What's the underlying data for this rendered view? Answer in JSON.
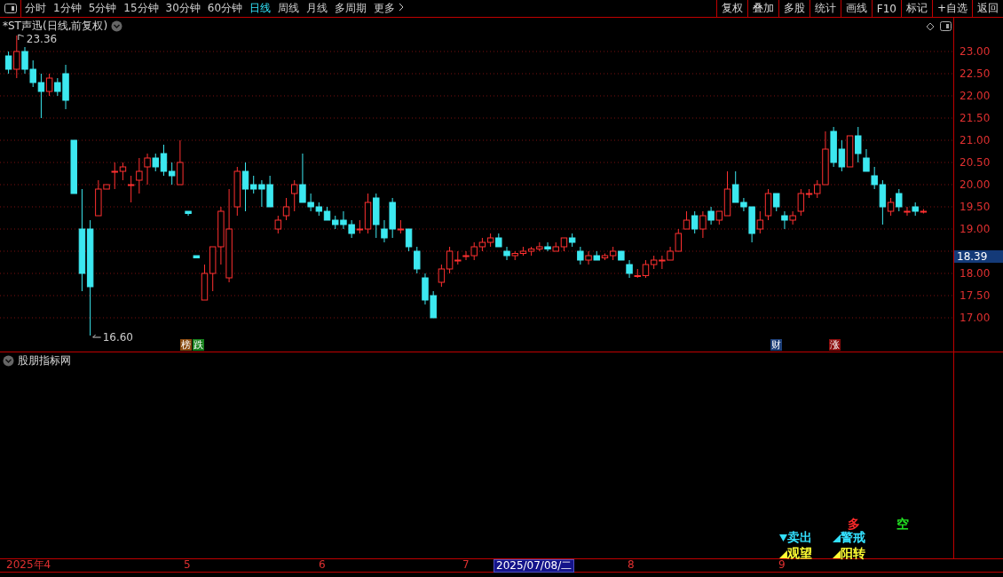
{
  "toolbar": {
    "periods": [
      {
        "label": "分时",
        "selected": false
      },
      {
        "label": "1分钟",
        "selected": false
      },
      {
        "label": "5分钟",
        "selected": false
      },
      {
        "label": "15分钟",
        "selected": false
      },
      {
        "label": "30分钟",
        "selected": false
      },
      {
        "label": "60分钟",
        "selected": false
      },
      {
        "label": "日线",
        "selected": true
      },
      {
        "label": "周线",
        "selected": false
      },
      {
        "label": "月线",
        "selected": false
      },
      {
        "label": "多周期",
        "selected": false
      }
    ],
    "more": "更多",
    "actions": [
      "复权",
      "叠加",
      "多股",
      "统计",
      "画线",
      "F10",
      "标记",
      "+自选",
      "返回"
    ]
  },
  "chart": {
    "title": "*ST声迅(日线,前复权)",
    "high_label": "23.36",
    "low_label": "16.60",
    "current_price": "18.39",
    "chart_data": {
      "type": "candlestick",
      "ylim": [
        11.56,
        23.76
      ],
      "grid": true,
      "yticks": [
        {
          "value": 23,
          "label": "23.00"
        },
        {
          "value": 22.5,
          "label": "22.50"
        },
        {
          "value": 22,
          "label": "22.00"
        },
        {
          "value": 21.5,
          "label": "21.50"
        },
        {
          "value": 21,
          "label": "21.00"
        },
        {
          "value": 20.5,
          "label": "20.50"
        },
        {
          "value": 20,
          "label": "20.00"
        },
        {
          "value": 19.5,
          "label": "19.50"
        },
        {
          "value": 19,
          "label": "19.00"
        },
        {
          "value": 18,
          "label": "18.00"
        },
        {
          "value": 17.5,
          "label": "17.50"
        },
        {
          "value": 17,
          "label": "17.00"
        }
      ],
      "ohlc": [
        [
          22.9,
          23.0,
          22.5,
          22.6
        ],
        [
          22.6,
          23.36,
          22.4,
          23.0
        ],
        [
          23.0,
          23.1,
          22.5,
          22.6
        ],
        [
          22.6,
          22.8,
          22.2,
          22.3
        ],
        [
          22.3,
          22.5,
          21.5,
          22.1
        ],
        [
          22.1,
          22.5,
          22.0,
          22.4
        ],
        [
          22.3,
          22.4,
          22.0,
          22.1
        ],
        [
          22.5,
          22.7,
          21.7,
          21.9
        ],
        [
          21.0,
          21.0,
          19.8,
          19.8
        ],
        [
          19.0,
          19.9,
          17.6,
          18.0
        ],
        [
          19.0,
          19.2,
          16.6,
          17.7
        ],
        [
          19.3,
          20.1,
          19.3,
          19.9
        ],
        [
          19.9,
          20.0,
          19.9,
          20.0
        ],
        [
          20.3,
          20.5,
          19.9,
          20.3
        ],
        [
          20.3,
          20.5,
          20.1,
          20.4
        ],
        [
          20.0,
          20.2,
          19.6,
          20.0
        ],
        [
          20.1,
          20.6,
          19.8,
          20.3
        ],
        [
          20.4,
          20.7,
          20.0,
          20.6
        ],
        [
          20.6,
          20.7,
          20.3,
          20.4
        ],
        [
          20.7,
          20.9,
          20.2,
          20.3
        ],
        [
          20.3,
          20.5,
          20.0,
          20.2
        ],
        [
          20.0,
          21.0,
          20.0,
          20.5
        ],
        [
          19.4,
          19.4,
          19.3,
          19.35
        ],
        [
          18.4,
          18.4,
          18.35,
          18.35
        ],
        [
          17.4,
          18.2,
          17.4,
          18.0
        ],
        [
          18.0,
          18.6,
          17.6,
          18.6
        ],
        [
          18.6,
          19.5,
          18.2,
          19.4
        ],
        [
          17.9,
          19.9,
          17.8,
          19.0
        ],
        [
          19.5,
          20.4,
          19.3,
          20.3
        ],
        [
          20.3,
          20.5,
          19.4,
          19.9
        ],
        [
          20.0,
          20.2,
          19.8,
          19.9
        ],
        [
          20.0,
          20.1,
          19.5,
          19.9
        ],
        [
          20.0,
          20.2,
          19.5,
          19.5
        ],
        [
          19.0,
          19.3,
          18.9,
          19.2
        ],
        [
          19.3,
          19.7,
          19.2,
          19.5
        ],
        [
          19.8,
          20.1,
          19.4,
          20.0
        ],
        [
          20.0,
          20.7,
          19.6,
          19.6
        ],
        [
          19.6,
          19.8,
          19.4,
          19.5
        ],
        [
          19.5,
          19.6,
          19.3,
          19.4
        ],
        [
          19.4,
          19.5,
          19.2,
          19.2
        ],
        [
          19.2,
          19.3,
          19.0,
          19.1
        ],
        [
          19.2,
          19.4,
          19.0,
          19.1
        ],
        [
          19.1,
          19.2,
          18.8,
          18.9
        ],
        [
          19.0,
          19.2,
          18.9,
          19.0
        ],
        [
          19.0,
          19.8,
          18.9,
          19.6
        ],
        [
          19.7,
          19.8,
          18.8,
          19.1
        ],
        [
          19.0,
          19.2,
          18.7,
          18.8
        ],
        [
          19.6,
          19.7,
          18.8,
          19.0
        ],
        [
          19.0,
          19.2,
          18.9,
          19.0
        ],
        [
          19.0,
          19.0,
          18.5,
          18.6
        ],
        [
          18.5,
          18.6,
          18.0,
          18.1
        ],
        [
          17.9,
          18.0,
          17.3,
          17.4
        ],
        [
          17.5,
          17.6,
          17.0,
          17.0
        ],
        [
          17.8,
          18.2,
          17.7,
          18.1
        ],
        [
          18.1,
          18.6,
          18.0,
          18.5
        ],
        [
          18.3,
          18.5,
          18.2,
          18.3
        ],
        [
          18.4,
          18.5,
          18.3,
          18.4
        ],
        [
          18.4,
          18.7,
          18.3,
          18.6
        ],
        [
          18.6,
          18.8,
          18.5,
          18.7
        ],
        [
          18.7,
          18.9,
          18.6,
          18.8
        ],
        [
          18.8,
          18.9,
          18.6,
          18.6
        ],
        [
          18.5,
          18.6,
          18.3,
          18.4
        ],
        [
          18.4,
          18.5,
          18.3,
          18.45
        ],
        [
          18.45,
          18.6,
          18.4,
          18.5
        ],
        [
          18.5,
          18.6,
          18.4,
          18.55
        ],
        [
          18.55,
          18.7,
          18.5,
          18.6
        ],
        [
          18.6,
          18.7,
          18.5,
          18.55
        ],
        [
          18.5,
          18.7,
          18.5,
          18.6
        ],
        [
          18.6,
          18.8,
          18.5,
          18.8
        ],
        [
          18.8,
          18.9,
          18.6,
          18.7
        ],
        [
          18.5,
          18.6,
          18.2,
          18.3
        ],
        [
          18.3,
          18.5,
          18.2,
          18.4
        ],
        [
          18.4,
          18.5,
          18.3,
          18.3
        ],
        [
          18.35,
          18.45,
          18.3,
          18.4
        ],
        [
          18.4,
          18.6,
          18.3,
          18.5
        ],
        [
          18.5,
          18.5,
          18.3,
          18.3
        ],
        [
          18.2,
          18.3,
          17.9,
          18.0
        ],
        [
          17.95,
          18.1,
          17.9,
          17.95
        ],
        [
          17.95,
          18.3,
          17.9,
          18.2
        ],
        [
          18.2,
          18.4,
          18.1,
          18.3
        ],
        [
          18.3,
          18.4,
          18.1,
          18.3
        ],
        [
          18.3,
          18.6,
          18.3,
          18.5
        ],
        [
          18.5,
          19.0,
          18.5,
          18.9
        ],
        [
          19.0,
          19.4,
          19.0,
          19.2
        ],
        [
          19.3,
          19.4,
          18.9,
          19.0
        ],
        [
          19.0,
          19.4,
          18.8,
          19.3
        ],
        [
          19.4,
          19.5,
          19.1,
          19.2
        ],
        [
          19.2,
          19.4,
          19.1,
          19.4
        ],
        [
          19.3,
          20.3,
          19.3,
          19.9
        ],
        [
          20.0,
          20.3,
          19.6,
          19.6
        ],
        [
          19.6,
          19.7,
          19.4,
          19.5
        ],
        [
          19.5,
          19.5,
          18.7,
          18.9
        ],
        [
          19.0,
          19.4,
          18.9,
          19.2
        ],
        [
          19.3,
          19.9,
          19.2,
          19.8
        ],
        [
          19.8,
          19.8,
          19.4,
          19.5
        ],
        [
          19.3,
          19.4,
          19.0,
          19.2
        ],
        [
          19.2,
          19.4,
          19.1,
          19.3
        ],
        [
          19.4,
          19.9,
          19.3,
          19.8
        ],
        [
          19.8,
          19.9,
          19.7,
          19.8
        ],
        [
          19.8,
          20.1,
          19.7,
          20.0
        ],
        [
          20.0,
          21.2,
          20.0,
          20.8
        ],
        [
          21.2,
          21.3,
          20.4,
          20.5
        ],
        [
          20.8,
          21.0,
          20.3,
          20.4
        ],
        [
          20.4,
          21.1,
          20.4,
          21.1
        ],
        [
          21.1,
          21.3,
          20.5,
          20.7
        ],
        [
          20.6,
          20.8,
          20.3,
          20.3
        ],
        [
          20.2,
          20.4,
          19.9,
          20.0
        ],
        [
          20.0,
          20.1,
          19.1,
          19.5
        ],
        [
          19.4,
          19.7,
          19.3,
          19.6
        ],
        [
          19.8,
          19.9,
          19.4,
          19.5
        ],
        [
          19.4,
          19.5,
          19.3,
          19.4
        ],
        [
          19.5,
          19.6,
          19.3,
          19.4
        ],
        [
          19.4,
          19.45,
          19.35,
          19.4
        ]
      ]
    },
    "events": [
      {
        "label": "榜",
        "color": "#8a4a10"
      },
      {
        "label": "跌",
        "color": "#17801d"
      },
      {
        "label": "财",
        "color": "#1d3f78"
      },
      {
        "label": "涨",
        "color": "#8a0c0c"
      }
    ]
  },
  "indicator": {
    "title": "股朋指标网",
    "signals": [
      {
        "label": "多",
        "kind": "plain",
        "color": "#ff2a2a"
      },
      {
        "label": "空",
        "kind": "plain",
        "color": "#22e022"
      },
      {
        "label": "卖出",
        "kind": "down",
        "color": "#33e0ff"
      },
      {
        "label": "警戒",
        "kind": "corner",
        "color": "#33e0ff"
      },
      {
        "label": "观望",
        "kind": "corner",
        "color": "#ffff33"
      },
      {
        "label": "阳转",
        "kind": "corner",
        "color": "#ffff33"
      }
    ]
  },
  "date_axis": [
    {
      "label": "2025年4",
      "selected": false
    },
    {
      "label": "5",
      "selected": false
    },
    {
      "label": "6",
      "selected": false
    },
    {
      "label": "7",
      "selected": false
    },
    {
      "label": "2025/07/08/二",
      "selected": true
    },
    {
      "label": "8",
      "selected": false
    },
    {
      "label": "9",
      "selected": false
    }
  ]
}
